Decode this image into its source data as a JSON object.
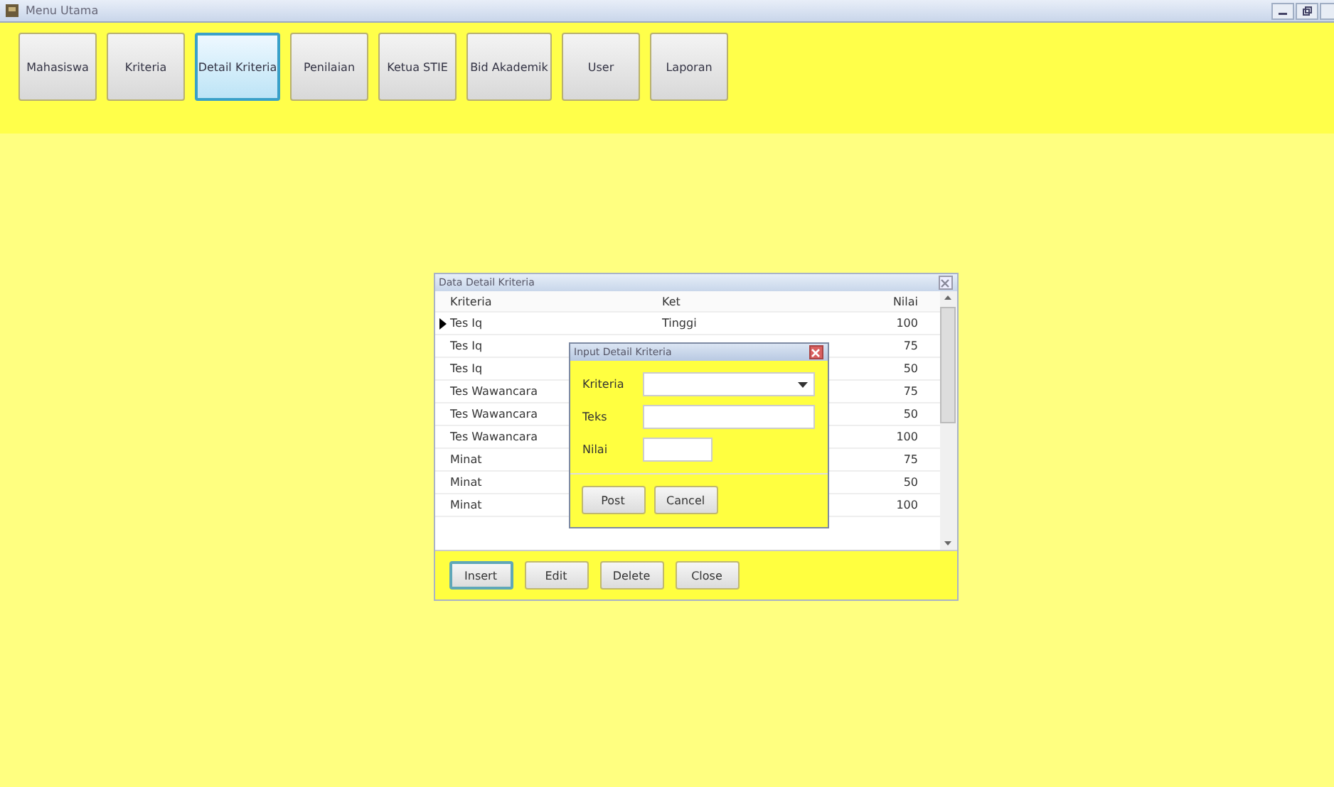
{
  "window": {
    "title": "Menu Utama"
  },
  "toolbar": [
    {
      "label": "Mahasiswa",
      "selected": false
    },
    {
      "label": "Kriteria",
      "selected": false
    },
    {
      "label": "Detail Kriteria",
      "selected": true
    },
    {
      "label": "Penilaian",
      "selected": false
    },
    {
      "label": "Ketua STIE",
      "selected": false
    },
    {
      "label": "Bid Akademik",
      "selected": false
    },
    {
      "label": "User",
      "selected": false
    },
    {
      "label": "Laporan",
      "selected": false
    }
  ],
  "data_window": {
    "title": "Data Detail Kriteria",
    "columns": [
      "Kriteria",
      "Ket",
      "Nilai"
    ],
    "rows": [
      {
        "kriteria": "Tes Iq",
        "ket": "Tinggi",
        "nilai": "100",
        "selected": true
      },
      {
        "kriteria": "Tes Iq",
        "nilai": "75",
        "selected": false
      },
      {
        "kriteria": "Tes Iq",
        "nilai": "50",
        "selected": false
      },
      {
        "kriteria": "Tes Wawancara",
        "nilai": "75",
        "selected": false
      },
      {
        "kriteria": "Tes Wawancara",
        "nilai": "50",
        "selected": false
      },
      {
        "kriteria": "Tes Wawancara",
        "nilai": "100",
        "selected": false
      },
      {
        "kriteria": "Minat",
        "nilai": "75",
        "selected": false
      },
      {
        "kriteria": "Minat",
        "nilai": "50",
        "selected": false
      },
      {
        "kriteria": "Minat",
        "nilai": "100",
        "selected": false
      }
    ],
    "buttons": [
      {
        "label": "Insert",
        "focused": true
      },
      {
        "label": "Edit",
        "focused": false
      },
      {
        "label": "Delete",
        "focused": false
      },
      {
        "label": "Close",
        "focused": false
      }
    ]
  },
  "dialog": {
    "title": "Input Detail Kriteria",
    "fields": [
      {
        "label": "Kriteria",
        "kind": "dropdown"
      },
      {
        "label": "Teks",
        "kind": "text"
      },
      {
        "label": "Nilai",
        "kind": "short"
      }
    ],
    "buttons": [
      "Post",
      "Cancel"
    ]
  }
}
